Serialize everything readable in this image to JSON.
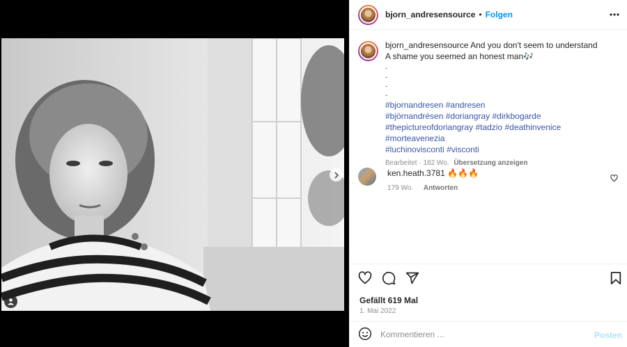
{
  "post": {
    "username": "bjorn_andresensource",
    "separator": "•",
    "follow_label": "Folgen"
  },
  "caption": {
    "username": "bjorn_andresensource",
    "line1": "And you don't seem to understand",
    "line2": "A shame you seemed an honest man🎶",
    "dots": [
      ".",
      ".",
      ".",
      "."
    ],
    "hashtags": [
      [
        "#bjornandresen",
        "#andresen"
      ],
      [
        "#björnandrésen",
        "#doriangray",
        "#dirkbogarde"
      ],
      [
        "#thepictureofdoriangray",
        "#tadzio",
        "#deathinvenice",
        "#morteavenezia"
      ],
      [
        "#luchinovisconti",
        "#visconti"
      ]
    ],
    "meta_time": "Bearbeitet · 182 Wo.",
    "meta_link": "Übersetzung anzeigen"
  },
  "comment": {
    "username": "ken.heath.3781",
    "text": "🔥🔥🔥",
    "time": "179 Wo.",
    "reply_label": "Antworten"
  },
  "likes": "Gefällt 619 Mal",
  "date": "1. Mai 2022",
  "add_comment": {
    "placeholder": "Kommentieren ...",
    "post_label": "Posten"
  },
  "icons": {
    "more": "more-options-icon",
    "like": "heart-icon",
    "comment": "comment-icon",
    "share": "share-icon",
    "save": "bookmark-icon",
    "emoji": "emoji-icon",
    "next": "chevron-right-icon",
    "tag": "user-tag-icon"
  },
  "colors": {
    "link_blue": "#0095f6",
    "hashtag": "#3b55a8",
    "muted": "#8e8e8e",
    "post_disabled": "#b2dffc"
  }
}
